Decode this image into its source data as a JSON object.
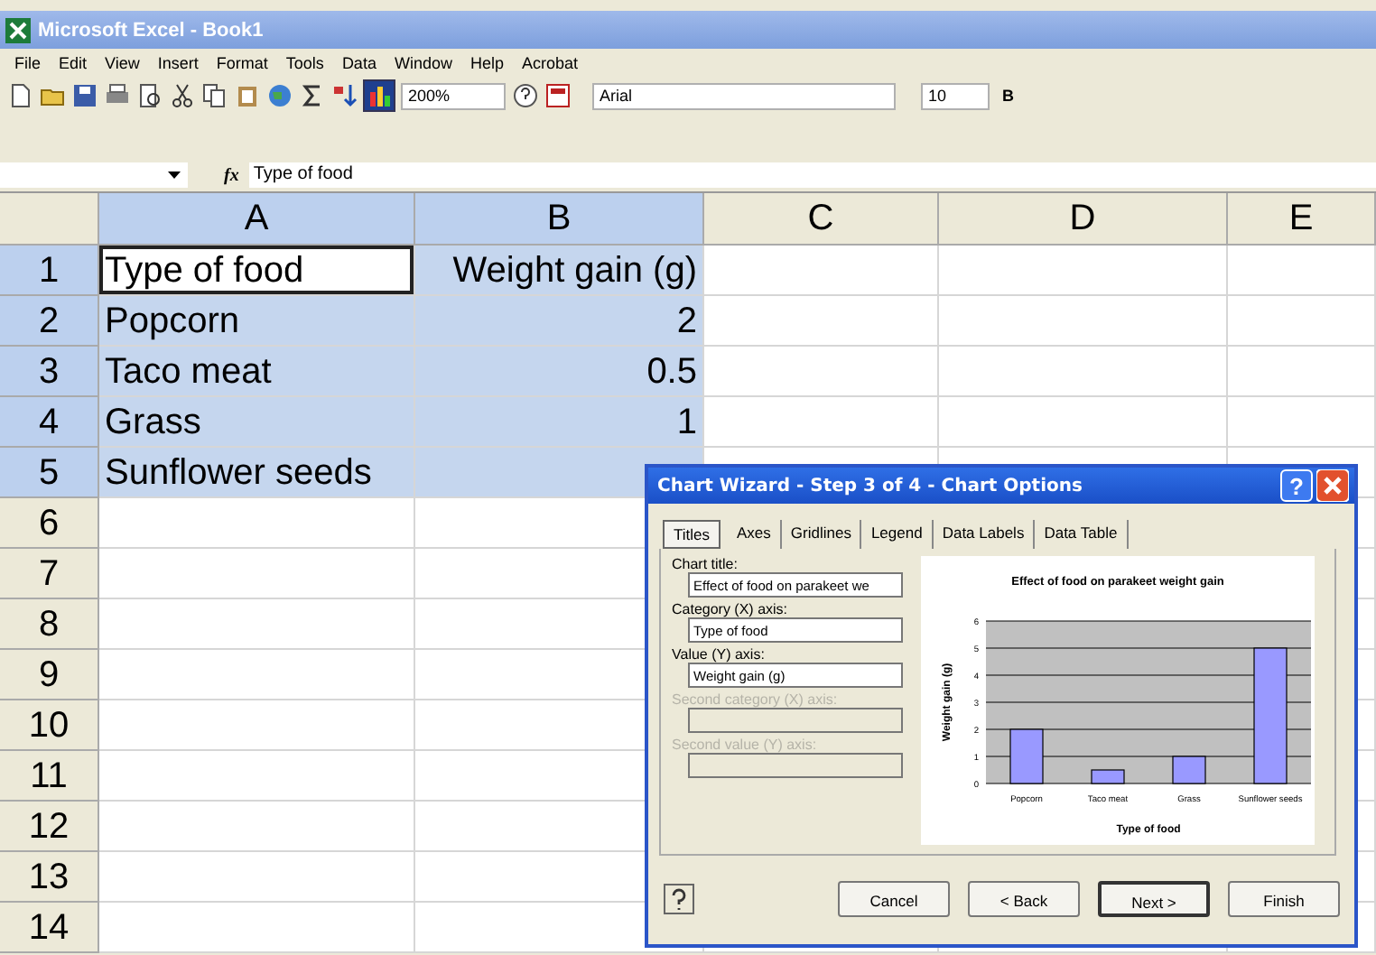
{
  "window": {
    "title": "Microsoft Excel - Book1"
  },
  "menu": [
    "File",
    "Edit",
    "View",
    "Insert",
    "Format",
    "Tools",
    "Data",
    "Window",
    "Help",
    "Acrobat"
  ],
  "toolbar": {
    "zoom": "200%",
    "font": "Arial",
    "size": "10",
    "bold": "B"
  },
  "formula_bar": {
    "fx": "fx",
    "content": "Type of food"
  },
  "sheet": {
    "columns": [
      {
        "label": "A",
        "selected": true
      },
      {
        "label": "B",
        "selected": true
      },
      {
        "label": "C",
        "selected": false
      },
      {
        "label": "D",
        "selected": false
      },
      {
        "label": "E",
        "selected": false
      }
    ],
    "rows": [
      {
        "number": "1",
        "selected": true,
        "cells": [
          {
            "text": "Type of food",
            "active": true
          },
          {
            "text": "Weight gain (g)",
            "active": false
          }
        ]
      },
      {
        "number": "2",
        "selected": true,
        "cells": [
          {
            "text": "Popcorn",
            "active": false
          },
          {
            "text": "2",
            "active": false
          }
        ]
      },
      {
        "number": "3",
        "selected": true,
        "cells": [
          {
            "text": "Taco meat",
            "active": false
          },
          {
            "text": "0.5",
            "active": false
          }
        ]
      },
      {
        "number": "4",
        "selected": true,
        "cells": [
          {
            "text": "Grass",
            "active": false
          },
          {
            "text": "1",
            "active": false
          }
        ]
      },
      {
        "number": "5",
        "selected": true,
        "cells": [
          {
            "text": "Sunflower seeds",
            "active": false
          }
        ]
      },
      {
        "number": "6",
        "selected": false
      },
      {
        "number": "7",
        "selected": false
      },
      {
        "number": "8",
        "selected": false
      },
      {
        "number": "9",
        "selected": false
      },
      {
        "number": "10",
        "selected": false
      },
      {
        "number": "11",
        "selected": false
      },
      {
        "number": "12",
        "selected": false
      },
      {
        "number": "13",
        "selected": false
      },
      {
        "number": "14",
        "selected": false
      }
    ]
  },
  "dialog": {
    "title": "Chart Wizard - Step 3 of 4 - Chart Options",
    "help_glyph": "?",
    "tabs": [
      {
        "label": "Titles",
        "selected": true
      },
      {
        "label": "Axes",
        "selected": false
      },
      {
        "label": "Gridlines",
        "selected": false
      },
      {
        "label": "Legend",
        "selected": false
      },
      {
        "label": "Data Labels",
        "selected": false
      },
      {
        "label": "Data Table",
        "selected": false
      }
    ],
    "fields": [
      {
        "label": "Chart title:",
        "value": "Effect of food on parakeet we",
        "disabled": false
      },
      {
        "label": "Category (X) axis:",
        "value": "Type of food",
        "disabled": false
      },
      {
        "label": "Value (Y) axis:",
        "value": "Weight gain (g)",
        "disabled": false
      },
      {
        "label": "Second category (X) axis:",
        "disabled": true
      },
      {
        "label": "Second value (Y) axis:",
        "disabled": true
      }
    ],
    "chart_data": {
      "type": "bar",
      "title": "Effect of food on parakeet weight gain",
      "xlabel": "Type of food",
      "ylabel": "Weight gain (g)",
      "categories": [
        "Popcorn",
        "Taco meat",
        "Grass",
        "Sunflower seeds"
      ],
      "values": [
        2,
        0.5,
        1,
        5
      ],
      "grid": true,
      "ylim": [
        0,
        6
      ],
      "yticks": [
        0,
        1,
        2,
        3,
        4,
        5,
        6
      ]
    },
    "buttons": [
      {
        "label": "Cancel",
        "default": false
      },
      {
        "label": "< Back",
        "default": false
      },
      {
        "label": "Next >",
        "default": true
      },
      {
        "label": "Finish",
        "default": false
      }
    ]
  }
}
